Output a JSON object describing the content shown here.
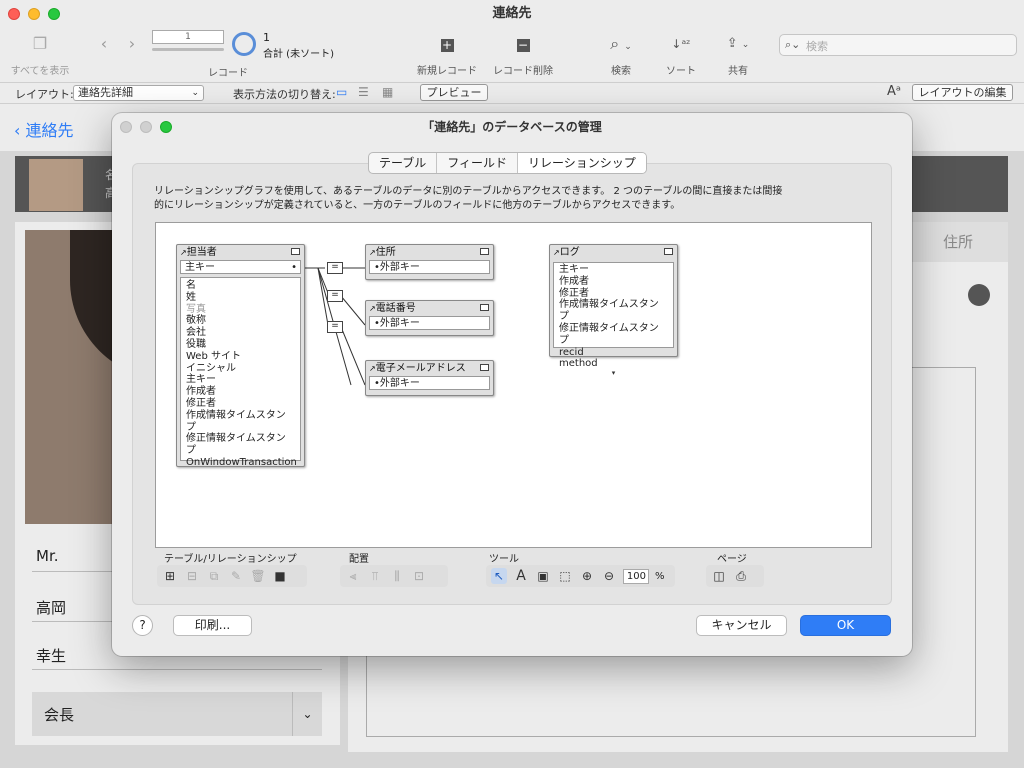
{
  "window": {
    "title": "連絡先"
  },
  "toolbar": {
    "show_all": "すべてを表示",
    "record_label": "レコード",
    "record_number": "1",
    "record_count": "1",
    "record_status": "合計 (未ソート)",
    "new_record": "新規レコード",
    "delete_record": "レコード削除",
    "find": "検索",
    "sort": "ソート",
    "share": "共有",
    "search_placeholder": "検索"
  },
  "layoutbar": {
    "layout_label": "レイアウト:",
    "layout_value": "連絡先詳細",
    "view_as_label": "表示方法の切り替え:",
    "preview": "プレビュー",
    "edit_layout": "レイアウトの編集"
  },
  "background": {
    "back_link": "連絡先",
    "tab_address": "住所",
    "name_initial_1": "名",
    "name_initial_2": "高",
    "fields": [
      "Mr.",
      "高岡",
      "幸生",
      "会長"
    ]
  },
  "dialog": {
    "title": "「連絡先」のデータベースの管理",
    "tabs": [
      {
        "label": "テーブル",
        "active": false
      },
      {
        "label": "フィールド",
        "active": false
      },
      {
        "label": "リレーションシップ",
        "active": true
      }
    ],
    "description_line1": "リレーションシップグラフを使用して、あるテーブルのデータに別のテーブルからアクセスできます。 2 つのテーブルの間に直接または間接",
    "description_line2": "的にリレーションシップが定義されていると、一方のテーブルのフィールドに他方のテーブルからアクセスできます。",
    "tables": {
      "tantou": {
        "name": "担当者",
        "key": "主キー",
        "fields": [
          "名",
          "姓",
          "写真",
          "敬称",
          "会社",
          "役職",
          "Web サイト",
          "イニシャル",
          "主キー",
          "作成者",
          "修正者",
          "作成情報タイムスタンプ",
          "修正情報タイムスタンプ",
          "OnWindowTransaction"
        ]
      },
      "address": {
        "name": "住所",
        "key": "外部キー"
      },
      "phone": {
        "name": "電話番号",
        "key": "外部キー"
      },
      "email": {
        "name": "電子メールアドレス",
        "key": "外部キー"
      },
      "log": {
        "name": "ログ",
        "fields": [
          "主キー",
          "作成者",
          "修正者",
          "作成情報タイムスタンプ",
          "修正情報タイムスタンプ",
          "recid",
          "method"
        ]
      }
    },
    "groups": {
      "tables_rel": "テーブル/リレーションシップ",
      "arrange": "配置",
      "tools": "ツール",
      "page": "ページ"
    },
    "zoom_value": "100",
    "zoom_unit": "%",
    "help": "?",
    "print": "印刷...",
    "cancel": "キャンセル",
    "ok": "OK"
  }
}
